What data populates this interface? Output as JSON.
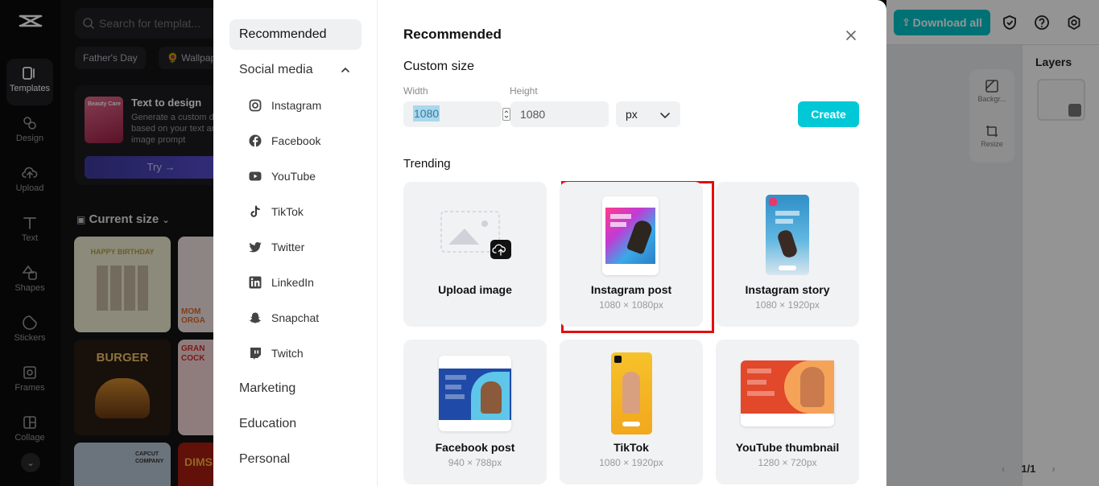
{
  "app": {
    "rail": [
      {
        "label": "Templates",
        "icon": "templates-icon"
      },
      {
        "label": "Design",
        "icon": "design-icon"
      },
      {
        "label": "Upload",
        "icon": "upload-icon"
      },
      {
        "label": "Text",
        "icon": "text-icon"
      },
      {
        "label": "Shapes",
        "icon": "shapes-icon"
      },
      {
        "label": "Stickers",
        "icon": "stickers-icon"
      },
      {
        "label": "Frames",
        "icon": "frames-icon"
      },
      {
        "label": "Collage",
        "icon": "collage-icon"
      }
    ],
    "search_placeholder": "Search for templat...",
    "chips": [
      "Father's Day",
      "Wallpap"
    ],
    "text_to_design": {
      "title": "Text to design",
      "thumb_text": "Beauty Care",
      "description": "Generate a custom design based on your text and image prompt",
      "button": "Try →"
    },
    "current_size": "Current size",
    "templates": [
      {
        "label": "HAPPY BIRTHDAY"
      },
      {
        "label": "MOM ORGA"
      },
      {
        "label": "BURGER"
      },
      {
        "label": "GRAN COCK"
      },
      {
        "label": "CAPCUT COMPANY"
      },
      {
        "label": "DIMS"
      }
    ],
    "download_label": "Download all",
    "side_tools": [
      "Backgr...",
      "Resize"
    ],
    "layers_title": "Layers",
    "pager": "1/1"
  },
  "modal": {
    "nav": {
      "recommended": "Recommended",
      "social_media": "Social media",
      "social_items": [
        {
          "label": "Instagram",
          "icon": "instagram-icon"
        },
        {
          "label": "Facebook",
          "icon": "facebook-icon"
        },
        {
          "label": "YouTube",
          "icon": "youtube-icon"
        },
        {
          "label": "TikTok",
          "icon": "tiktok-icon"
        },
        {
          "label": "Twitter",
          "icon": "twitter-icon"
        },
        {
          "label": "LinkedIn",
          "icon": "linkedin-icon"
        },
        {
          "label": "Snapchat",
          "icon": "snapchat-icon"
        },
        {
          "label": "Twitch",
          "icon": "twitch-icon"
        }
      ],
      "marketing": "Marketing",
      "education": "Education",
      "personal": "Personal"
    },
    "title": "Recommended",
    "custom_size": {
      "heading": "Custom size",
      "width_label": "Width",
      "width_value": "1080",
      "height_label": "Height",
      "height_value": "1080",
      "unit": "px",
      "create_label": "Create"
    },
    "trending_heading": "Trending",
    "cards": [
      {
        "name": "Upload image",
        "dim": ""
      },
      {
        "name": "Instagram post",
        "dim": "1080 × 1080px"
      },
      {
        "name": "Instagram story",
        "dim": "1080 × 1920px"
      },
      {
        "name": "Facebook post",
        "dim": "940 × 788px"
      },
      {
        "name": "TikTok",
        "dim": "1080 × 1920px"
      },
      {
        "name": "YouTube thumbnail",
        "dim": "1280 × 720px"
      }
    ]
  }
}
